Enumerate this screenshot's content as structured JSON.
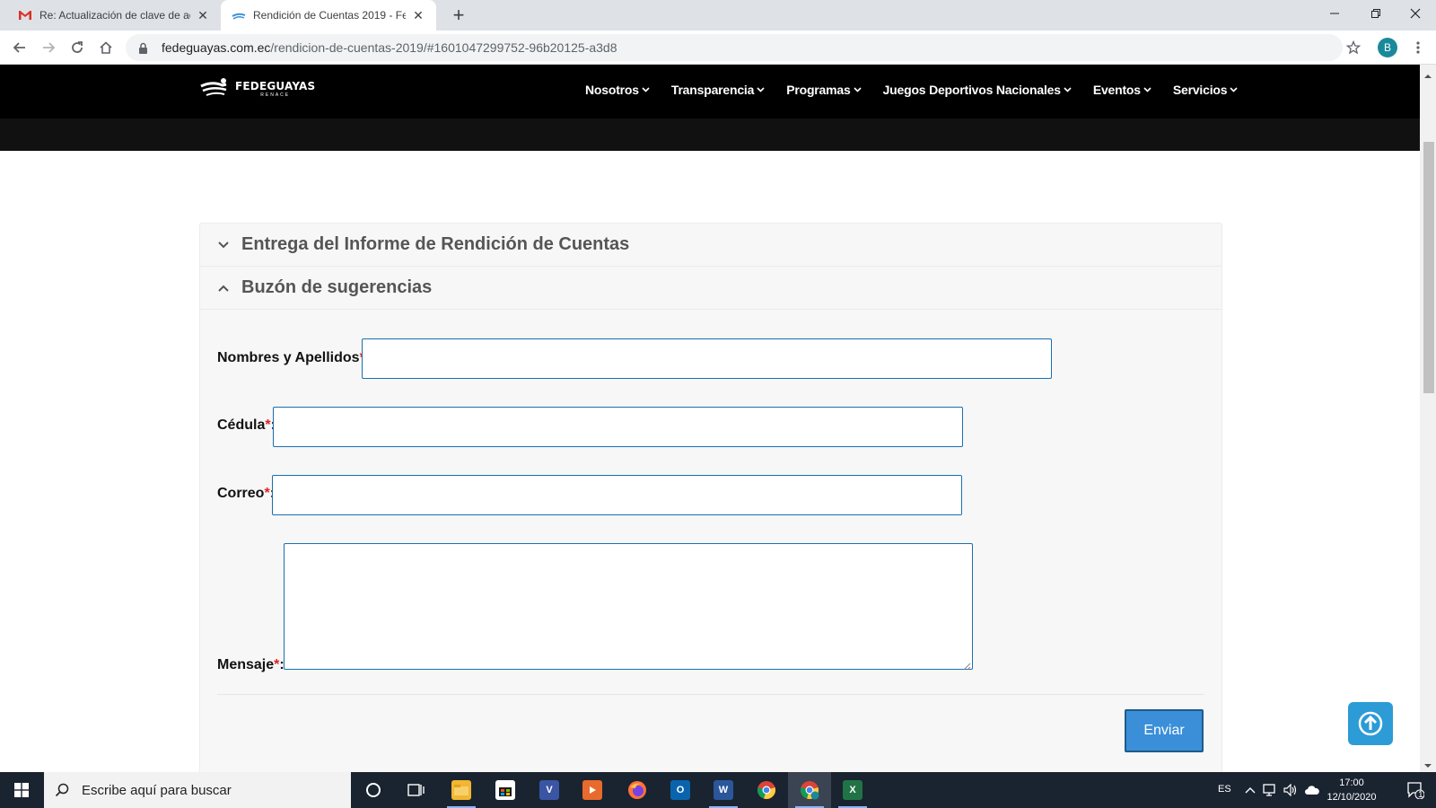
{
  "browser": {
    "tabs": [
      {
        "title": "Re: Actualización de clave de acc",
        "favicon": "gmail-icon",
        "active": false
      },
      {
        "title": "Rendición de Cuentas 2019 - Fec",
        "favicon": "fedeguayas-favicon",
        "active": true
      }
    ],
    "url_host": "fedeguayas.com.ec",
    "url_path": "/rendicion-de-cuentas-2019/#1601047299752-96b20125-a3d8",
    "profile_initial": "B"
  },
  "site": {
    "logo_name": "FEDEGUAYAS",
    "logo_sub": "RENACE",
    "nav": [
      {
        "label": "Nosotros"
      },
      {
        "label": "Transparencia"
      },
      {
        "label": "Programas"
      },
      {
        "label": "Juegos Deportivos Nacionales"
      },
      {
        "label": "Eventos"
      },
      {
        "label": "Servicios"
      }
    ]
  },
  "accordion": {
    "section1_title": "Entrega del Informe de Rendición de Cuentas",
    "section2_title": "Buzón de sugerencias"
  },
  "form": {
    "name_label": "Nombres y Apellidos",
    "id_label": "Cédula",
    "email_label": "Correo",
    "message_label": "Mensaje",
    "required_mark": "*",
    "colon": ":",
    "name_value": "",
    "id_value": "",
    "email_value": "",
    "message_value": "",
    "submit_label": "Enviar"
  },
  "taskbar": {
    "search_placeholder": "Escribe aquí para buscar",
    "language": "ES",
    "time": "17:00",
    "date": "12/10/2020",
    "notification_count": "1"
  },
  "colors": {
    "header_bg": "#000000",
    "accent_blue": "#3a8fd8",
    "input_border": "#1a6fb0",
    "required_red": "#e02020"
  }
}
